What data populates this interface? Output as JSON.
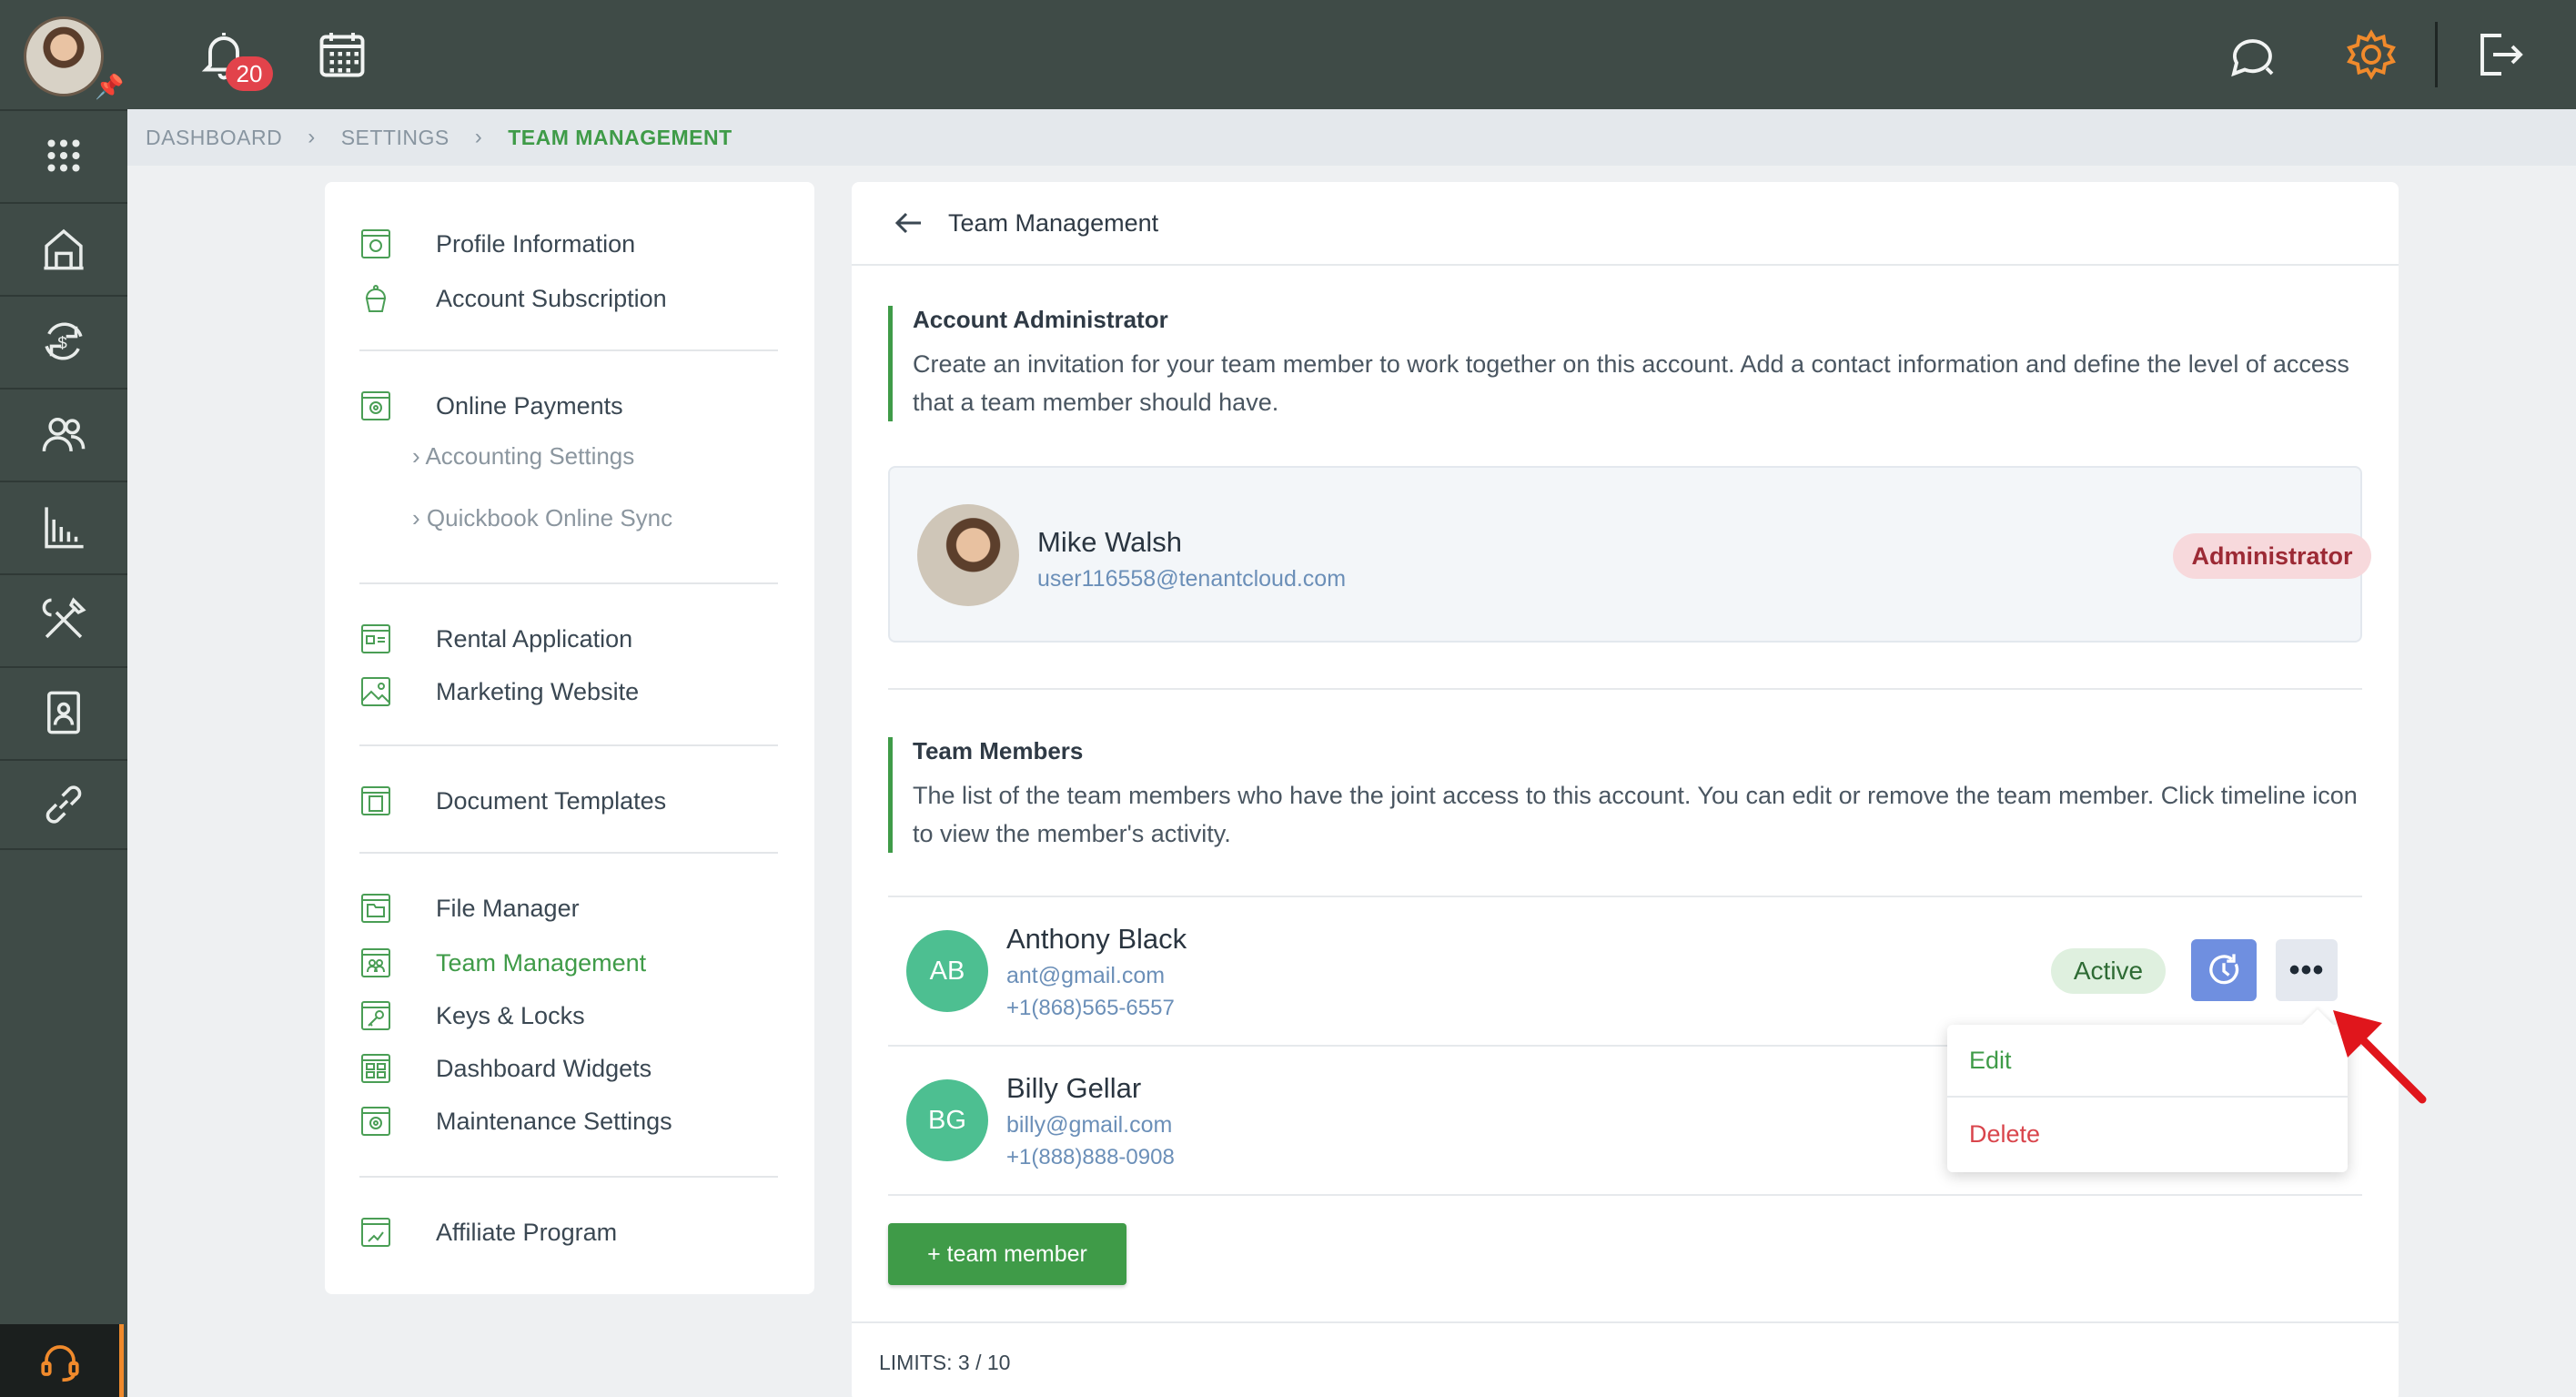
{
  "topbar": {
    "notifications_count": "20"
  },
  "breadcrumb": {
    "items": [
      "DASHBOARD",
      "SETTINGS",
      "TEAM MANAGEMENT"
    ]
  },
  "settings_menu": {
    "groups": [
      [
        "Profile Information",
        "Account Subscription"
      ],
      [
        "Online Payments"
      ],
      [
        "Rental Application",
        "Marketing Website"
      ],
      [
        "Document Templates"
      ],
      [
        "File Manager",
        "Team Management",
        "Keys & Locks",
        "Dashboard Widgets",
        "Maintenance Settings"
      ],
      [
        "Affiliate Program"
      ]
    ],
    "sub_items": [
      "Accounting Settings",
      "Quickbook Online Sync"
    ],
    "active": "Team Management"
  },
  "main": {
    "title": "Team Management",
    "admin_section": {
      "heading": "Account Administrator",
      "description": "Create an invitation for your team member to work together on this account. Add a contact information and define the level of access that a team member should have."
    },
    "admin": {
      "name": "Mike Walsh",
      "email": "user116558@tenantcloud.com",
      "role": "Administrator"
    },
    "members_section": {
      "heading": "Team Members",
      "description": "The list of the team members who have the joint access to this account. You can edit or remove the team member. Click timeline icon to view the member's activity."
    },
    "members": [
      {
        "initials": "AB",
        "name": "Anthony Black",
        "email": "ant@gmail.com",
        "phone": "+1(868)565-6557",
        "status": "Active"
      },
      {
        "initials": "BG",
        "name": "Billy Gellar",
        "email": "billy@gmail.com",
        "phone": "+1(888)888-0908"
      }
    ],
    "more_label": "•••",
    "dropdown": {
      "edit": "Edit",
      "delete": "Delete"
    },
    "add_button": "+ team member",
    "limits": "LIMITS: 3 / 10"
  },
  "colors": {
    "sidebar_bg": "#3f4b47",
    "accent_green": "#3f9b48",
    "active_pill": "#dff0df",
    "admin_pill": "#f7d9dc",
    "timeline_btn": "#6f8fe0",
    "avatar_green": "#4dbf91",
    "annotation_arrow": "#e0161c"
  }
}
